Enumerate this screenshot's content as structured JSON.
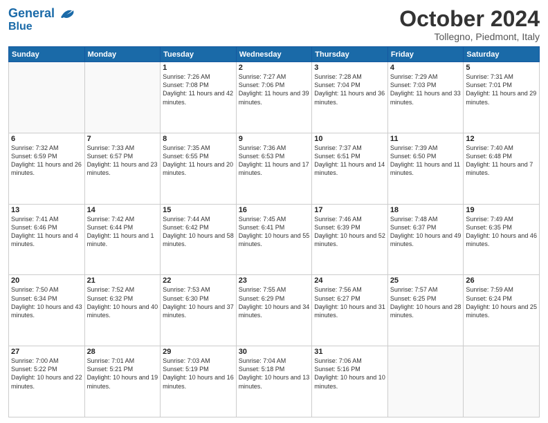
{
  "header": {
    "logo_line1": "General",
    "logo_line2": "Blue",
    "month": "October 2024",
    "location": "Tollegno, Piedmont, Italy"
  },
  "days_of_week": [
    "Sunday",
    "Monday",
    "Tuesday",
    "Wednesday",
    "Thursday",
    "Friday",
    "Saturday"
  ],
  "weeks": [
    [
      {
        "day": "",
        "sunrise": "",
        "sunset": "",
        "daylight": ""
      },
      {
        "day": "",
        "sunrise": "",
        "sunset": "",
        "daylight": ""
      },
      {
        "day": "1",
        "sunrise": "Sunrise: 7:26 AM",
        "sunset": "Sunset: 7:08 PM",
        "daylight": "Daylight: 11 hours and 42 minutes."
      },
      {
        "day": "2",
        "sunrise": "Sunrise: 7:27 AM",
        "sunset": "Sunset: 7:06 PM",
        "daylight": "Daylight: 11 hours and 39 minutes."
      },
      {
        "day": "3",
        "sunrise": "Sunrise: 7:28 AM",
        "sunset": "Sunset: 7:04 PM",
        "daylight": "Daylight: 11 hours and 36 minutes."
      },
      {
        "day": "4",
        "sunrise": "Sunrise: 7:29 AM",
        "sunset": "Sunset: 7:03 PM",
        "daylight": "Daylight: 11 hours and 33 minutes."
      },
      {
        "day": "5",
        "sunrise": "Sunrise: 7:31 AM",
        "sunset": "Sunset: 7:01 PM",
        "daylight": "Daylight: 11 hours and 29 minutes."
      }
    ],
    [
      {
        "day": "6",
        "sunrise": "Sunrise: 7:32 AM",
        "sunset": "Sunset: 6:59 PM",
        "daylight": "Daylight: 11 hours and 26 minutes."
      },
      {
        "day": "7",
        "sunrise": "Sunrise: 7:33 AM",
        "sunset": "Sunset: 6:57 PM",
        "daylight": "Daylight: 11 hours and 23 minutes."
      },
      {
        "day": "8",
        "sunrise": "Sunrise: 7:35 AM",
        "sunset": "Sunset: 6:55 PM",
        "daylight": "Daylight: 11 hours and 20 minutes."
      },
      {
        "day": "9",
        "sunrise": "Sunrise: 7:36 AM",
        "sunset": "Sunset: 6:53 PM",
        "daylight": "Daylight: 11 hours and 17 minutes."
      },
      {
        "day": "10",
        "sunrise": "Sunrise: 7:37 AM",
        "sunset": "Sunset: 6:51 PM",
        "daylight": "Daylight: 11 hours and 14 minutes."
      },
      {
        "day": "11",
        "sunrise": "Sunrise: 7:39 AM",
        "sunset": "Sunset: 6:50 PM",
        "daylight": "Daylight: 11 hours and 11 minutes."
      },
      {
        "day": "12",
        "sunrise": "Sunrise: 7:40 AM",
        "sunset": "Sunset: 6:48 PM",
        "daylight": "Daylight: 11 hours and 7 minutes."
      }
    ],
    [
      {
        "day": "13",
        "sunrise": "Sunrise: 7:41 AM",
        "sunset": "Sunset: 6:46 PM",
        "daylight": "Daylight: 11 hours and 4 minutes."
      },
      {
        "day": "14",
        "sunrise": "Sunrise: 7:42 AM",
        "sunset": "Sunset: 6:44 PM",
        "daylight": "Daylight: 11 hours and 1 minute."
      },
      {
        "day": "15",
        "sunrise": "Sunrise: 7:44 AM",
        "sunset": "Sunset: 6:42 PM",
        "daylight": "Daylight: 10 hours and 58 minutes."
      },
      {
        "day": "16",
        "sunrise": "Sunrise: 7:45 AM",
        "sunset": "Sunset: 6:41 PM",
        "daylight": "Daylight: 10 hours and 55 minutes."
      },
      {
        "day": "17",
        "sunrise": "Sunrise: 7:46 AM",
        "sunset": "Sunset: 6:39 PM",
        "daylight": "Daylight: 10 hours and 52 minutes."
      },
      {
        "day": "18",
        "sunrise": "Sunrise: 7:48 AM",
        "sunset": "Sunset: 6:37 PM",
        "daylight": "Daylight: 10 hours and 49 minutes."
      },
      {
        "day": "19",
        "sunrise": "Sunrise: 7:49 AM",
        "sunset": "Sunset: 6:35 PM",
        "daylight": "Daylight: 10 hours and 46 minutes."
      }
    ],
    [
      {
        "day": "20",
        "sunrise": "Sunrise: 7:50 AM",
        "sunset": "Sunset: 6:34 PM",
        "daylight": "Daylight: 10 hours and 43 minutes."
      },
      {
        "day": "21",
        "sunrise": "Sunrise: 7:52 AM",
        "sunset": "Sunset: 6:32 PM",
        "daylight": "Daylight: 10 hours and 40 minutes."
      },
      {
        "day": "22",
        "sunrise": "Sunrise: 7:53 AM",
        "sunset": "Sunset: 6:30 PM",
        "daylight": "Daylight: 10 hours and 37 minutes."
      },
      {
        "day": "23",
        "sunrise": "Sunrise: 7:55 AM",
        "sunset": "Sunset: 6:29 PM",
        "daylight": "Daylight: 10 hours and 34 minutes."
      },
      {
        "day": "24",
        "sunrise": "Sunrise: 7:56 AM",
        "sunset": "Sunset: 6:27 PM",
        "daylight": "Daylight: 10 hours and 31 minutes."
      },
      {
        "day": "25",
        "sunrise": "Sunrise: 7:57 AM",
        "sunset": "Sunset: 6:25 PM",
        "daylight": "Daylight: 10 hours and 28 minutes."
      },
      {
        "day": "26",
        "sunrise": "Sunrise: 7:59 AM",
        "sunset": "Sunset: 6:24 PM",
        "daylight": "Daylight: 10 hours and 25 minutes."
      }
    ],
    [
      {
        "day": "27",
        "sunrise": "Sunrise: 7:00 AM",
        "sunset": "Sunset: 5:22 PM",
        "daylight": "Daylight: 10 hours and 22 minutes."
      },
      {
        "day": "28",
        "sunrise": "Sunrise: 7:01 AM",
        "sunset": "Sunset: 5:21 PM",
        "daylight": "Daylight: 10 hours and 19 minutes."
      },
      {
        "day": "29",
        "sunrise": "Sunrise: 7:03 AM",
        "sunset": "Sunset: 5:19 PM",
        "daylight": "Daylight: 10 hours and 16 minutes."
      },
      {
        "day": "30",
        "sunrise": "Sunrise: 7:04 AM",
        "sunset": "Sunset: 5:18 PM",
        "daylight": "Daylight: 10 hours and 13 minutes."
      },
      {
        "day": "31",
        "sunrise": "Sunrise: 7:06 AM",
        "sunset": "Sunset: 5:16 PM",
        "daylight": "Daylight: 10 hours and 10 minutes."
      },
      {
        "day": "",
        "sunrise": "",
        "sunset": "",
        "daylight": ""
      },
      {
        "day": "",
        "sunrise": "",
        "sunset": "",
        "daylight": ""
      }
    ]
  ]
}
